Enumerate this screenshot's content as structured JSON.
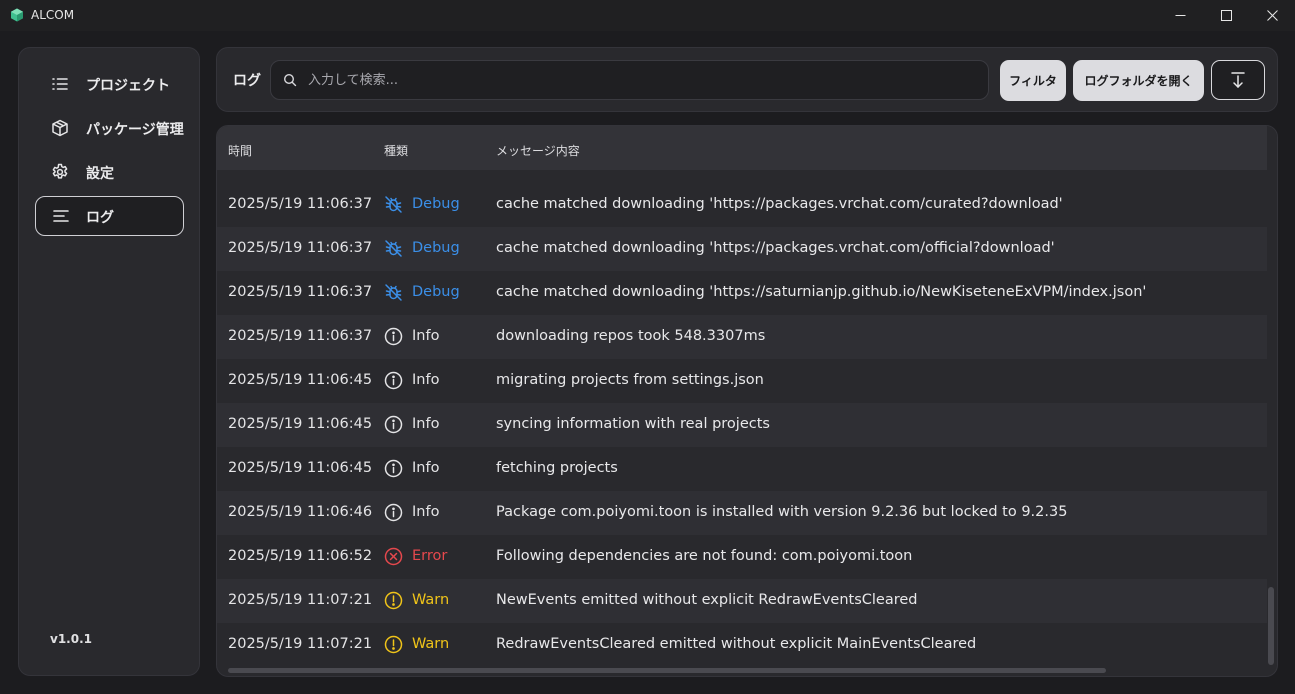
{
  "window": {
    "title": "ALCOM",
    "accent_color": "#3fbf8f"
  },
  "sidebar": {
    "items": [
      {
        "label": "プロジェクト",
        "icon": "list-icon"
      },
      {
        "label": "パッケージ管理",
        "icon": "package-icon"
      },
      {
        "label": "設定",
        "icon": "gear-icon"
      },
      {
        "label": "ログ",
        "icon": "log-lines-icon",
        "active": true
      }
    ],
    "version": "v1.0.1"
  },
  "toolbar": {
    "title": "ログ",
    "search_placeholder": "入力して検索...",
    "filter_label": "フィルタ",
    "open_folder_label": "ログフォルダを開く",
    "scroll_icon": "arrow-down-to-line-icon"
  },
  "table": {
    "headers": {
      "time": "時間",
      "type": "種類",
      "message": "メッセージ内容"
    },
    "level_colors": {
      "Debug": "#3b8fe8",
      "Info": "#e4e4e6",
      "Error": "#e5484d",
      "Warn": "#f0c419"
    },
    "rows": [
      {
        "time": "2025/5/19 11:06:37",
        "level": "Debug",
        "message": "cache matched downloading 'https://packages.vrchat.com/curated?download'"
      },
      {
        "time": "2025/5/19 11:06:37",
        "level": "Debug",
        "message": "cache matched downloading 'https://packages.vrchat.com/official?download'"
      },
      {
        "time": "2025/5/19 11:06:37",
        "level": "Debug",
        "message": "cache matched downloading 'https://saturnianjp.github.io/NewKiseteneExVPM/index.json'"
      },
      {
        "time": "2025/5/19 11:06:37",
        "level": "Info",
        "message": "downloading repos took 548.3307ms"
      },
      {
        "time": "2025/5/19 11:06:45",
        "level": "Info",
        "message": "migrating projects from settings.json"
      },
      {
        "time": "2025/5/19 11:06:45",
        "level": "Info",
        "message": "syncing information with real projects"
      },
      {
        "time": "2025/5/19 11:06:45",
        "level": "Info",
        "message": "fetching projects"
      },
      {
        "time": "2025/5/19 11:06:46",
        "level": "Info",
        "message": "Package com.poiyomi.toon is installed with version 9.2.36 but locked to 9.2.35"
      },
      {
        "time": "2025/5/19 11:06:52",
        "level": "Error",
        "message": "Following dependencies are not found: com.poiyomi.toon"
      },
      {
        "time": "2025/5/19 11:07:21",
        "level": "Warn",
        "message": "NewEvents emitted without explicit RedrawEventsCleared"
      },
      {
        "time": "2025/5/19 11:07:21",
        "level": "Warn",
        "message": "RedrawEventsCleared emitted without explicit MainEventsCleared"
      }
    ]
  }
}
